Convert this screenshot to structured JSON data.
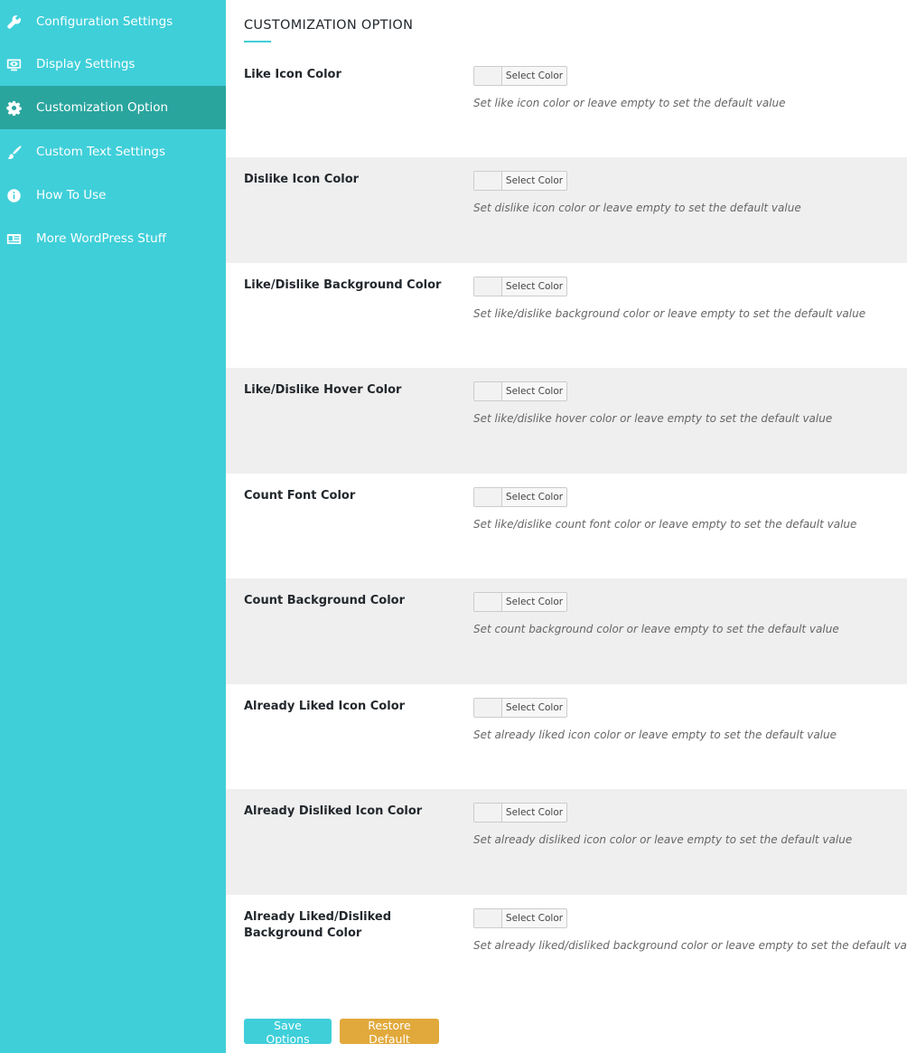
{
  "sidebar": {
    "items": [
      {
        "label": "Configuration Settings",
        "icon": "wrench-icon"
      },
      {
        "label": "Display Settings",
        "icon": "monitor-icon"
      },
      {
        "label": "Customization Option",
        "icon": "gear-icon",
        "active": true
      },
      {
        "label": "Custom Text Settings",
        "icon": "brush-icon"
      },
      {
        "label": "How To Use",
        "icon": "info-icon"
      },
      {
        "label": "More WordPress Stuff",
        "icon": "id-card-icon"
      }
    ]
  },
  "main": {
    "title": "CUSTOMIZATION OPTION",
    "picker_label": "Select Color",
    "rows": [
      {
        "label": "Like Icon Color",
        "description": "Set like icon color or leave empty to set the default value"
      },
      {
        "label": "Dislike Icon Color",
        "description": "Set dislike icon color or leave empty to set the default value"
      },
      {
        "label": "Like/Dislike Background Color",
        "description": "Set like/dislike background color or leave empty to set the default value"
      },
      {
        "label": "Like/Dislike Hover Color",
        "description": "Set like/dislike hover color or leave empty to set the default value"
      },
      {
        "label": "Count Font Color",
        "description": "Set like/dislike count font color or leave empty to set the default value"
      },
      {
        "label": "Count Background Color",
        "description": "Set count background color or leave empty to set the default value"
      },
      {
        "label": "Already Liked Icon Color",
        "description": "Set already liked icon color or leave empty to set the default value"
      },
      {
        "label": "Already Disliked Icon Color",
        "description": "Set already disliked icon color or leave empty to set the default value"
      },
      {
        "label": "Already Liked/Disliked Background Color",
        "description": "Set already liked/disliked background color or leave empty to set the default value"
      }
    ],
    "buttons": {
      "save": "Save Options",
      "restore": "Restore Default"
    }
  },
  "colors": {
    "accent": "#3fcfd9",
    "active": "#2aa59e",
    "restore": "#e1a93b",
    "alt_row": "#efefef"
  }
}
